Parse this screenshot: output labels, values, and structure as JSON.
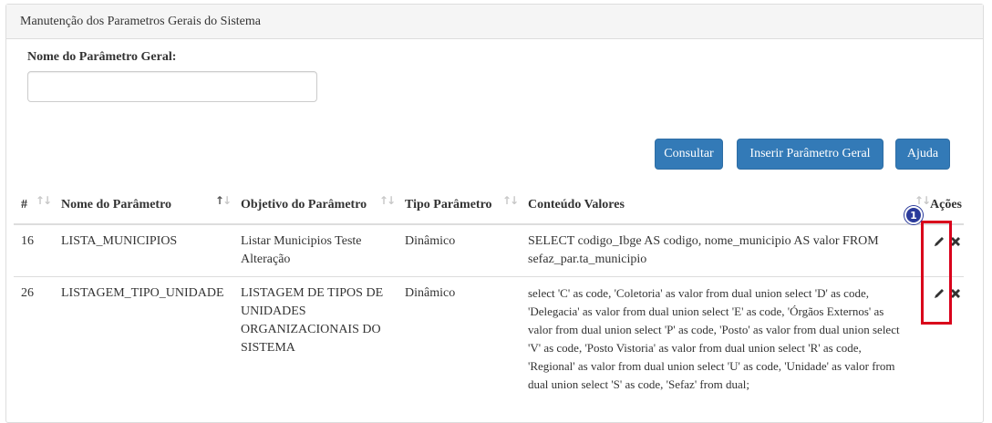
{
  "panel": {
    "title": "Manutenção dos Parametros Gerais do Sistema"
  },
  "form": {
    "label": "Nome do Parâmetro Geral:",
    "value": "",
    "placeholder": ""
  },
  "buttons": {
    "consultar": "Consultar",
    "inserir": "Inserir Parâmetro Geral",
    "ajuda": "Ajuda"
  },
  "table": {
    "headers": {
      "id": "#",
      "nome": "Nome do Parâmetro",
      "objetivo": "Objetivo do Parâmetro",
      "tipo": "Tipo Parâmetro",
      "conteudo": "Conteúdo Valores",
      "acoes": "Ações"
    },
    "rows": [
      {
        "id": "16",
        "nome": "LISTA_MUNICIPIOS",
        "objetivo": "Listar Municipios Teste Alteração",
        "tipo": "Dinâmico",
        "conteudo": "SELECT codigo_Ibge AS codigo, nome_municipio AS valor FROM sefaz_par.ta_municipio"
      },
      {
        "id": "26",
        "nome": "LISTAGEM_TIPO_UNIDADE",
        "objetivo": "LISTAGEM DE TIPOS DE UNIDADES ORGANIZACIONAIS DO SISTEMA",
        "tipo": "Dinâmico",
        "conteudo": "select 'C' as code, 'Coletoria' as valor from dual union select 'D' as code, 'Delegacia' as valor from dual union select 'E' as code, 'Órgãos Externos' as valor from dual union select 'P' as code, 'Posto' as valor from dual union select 'V' as code, 'Posto Vistoria' as valor from dual union select 'R' as code, 'Regional' as valor from dual union select 'U' as code, 'Unidade' as valor from dual union select 'S' as code, 'Sefaz' from dual;"
      }
    ]
  },
  "annotation": {
    "badge_number": "1",
    "highlight_color": "#d9001b",
    "badge_color": "#2a3a9b"
  },
  "icons": {
    "edit": "pencil-icon",
    "delete": "close-icon",
    "sort": "sort-arrows-icon"
  },
  "colors": {
    "primary": "#337ab7",
    "heading_bg": "#f5f5f5",
    "border": "#dddddd"
  }
}
